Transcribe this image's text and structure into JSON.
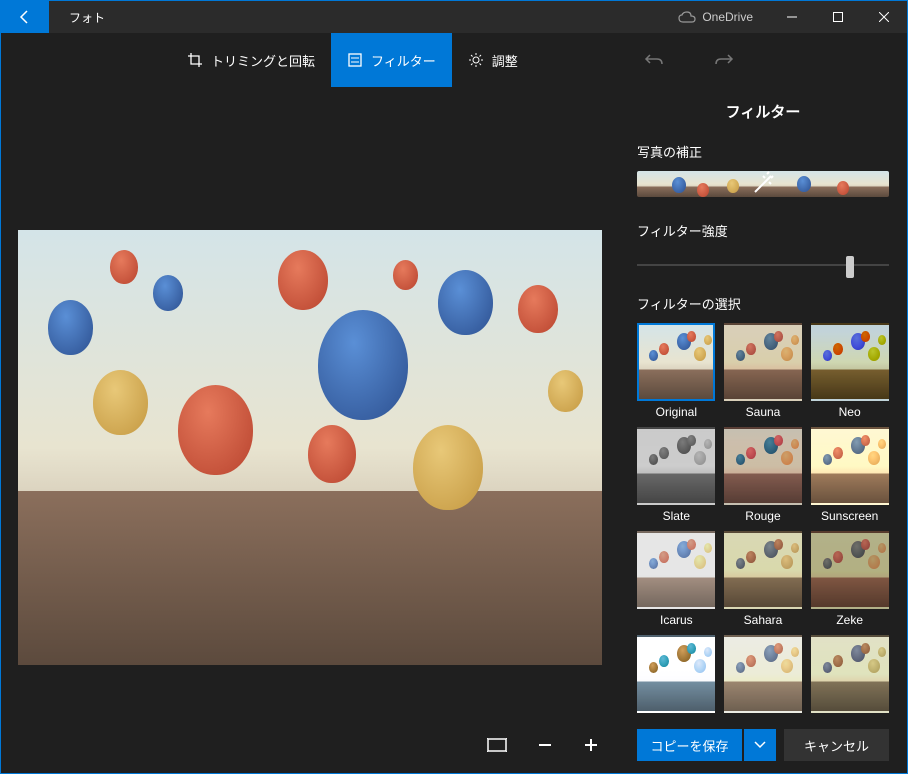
{
  "titlebar": {
    "app_name": "フォト",
    "cloud_label": "OneDrive"
  },
  "toolbar": {
    "crop_rotate": "トリミングと回転",
    "filter": "フィルター",
    "adjust": "調整"
  },
  "panel": {
    "title": "フィルター",
    "enhance_label": "写真の補正",
    "strength_label": "フィルター強度",
    "select_label": "フィルターの選択"
  },
  "filters": [
    {
      "name": "Original",
      "cls": "",
      "selected": true
    },
    {
      "name": "Sauna",
      "cls": "f-sauna"
    },
    {
      "name": "Neo",
      "cls": "f-neo"
    },
    {
      "name": "Slate",
      "cls": "f-slate"
    },
    {
      "name": "Rouge",
      "cls": "f-rouge"
    },
    {
      "name": "Sunscreen",
      "cls": "f-sun"
    },
    {
      "name": "Icarus",
      "cls": "f-icarus"
    },
    {
      "name": "Sahara",
      "cls": "f-sahara"
    },
    {
      "name": "Zeke",
      "cls": "f-zeke"
    },
    {
      "name": "",
      "cls": "f-x1"
    },
    {
      "name": "",
      "cls": "f-x2"
    },
    {
      "name": "",
      "cls": "f-x3"
    }
  ],
  "actions": {
    "save_copy": "コピーを保存",
    "cancel": "キャンセル"
  }
}
